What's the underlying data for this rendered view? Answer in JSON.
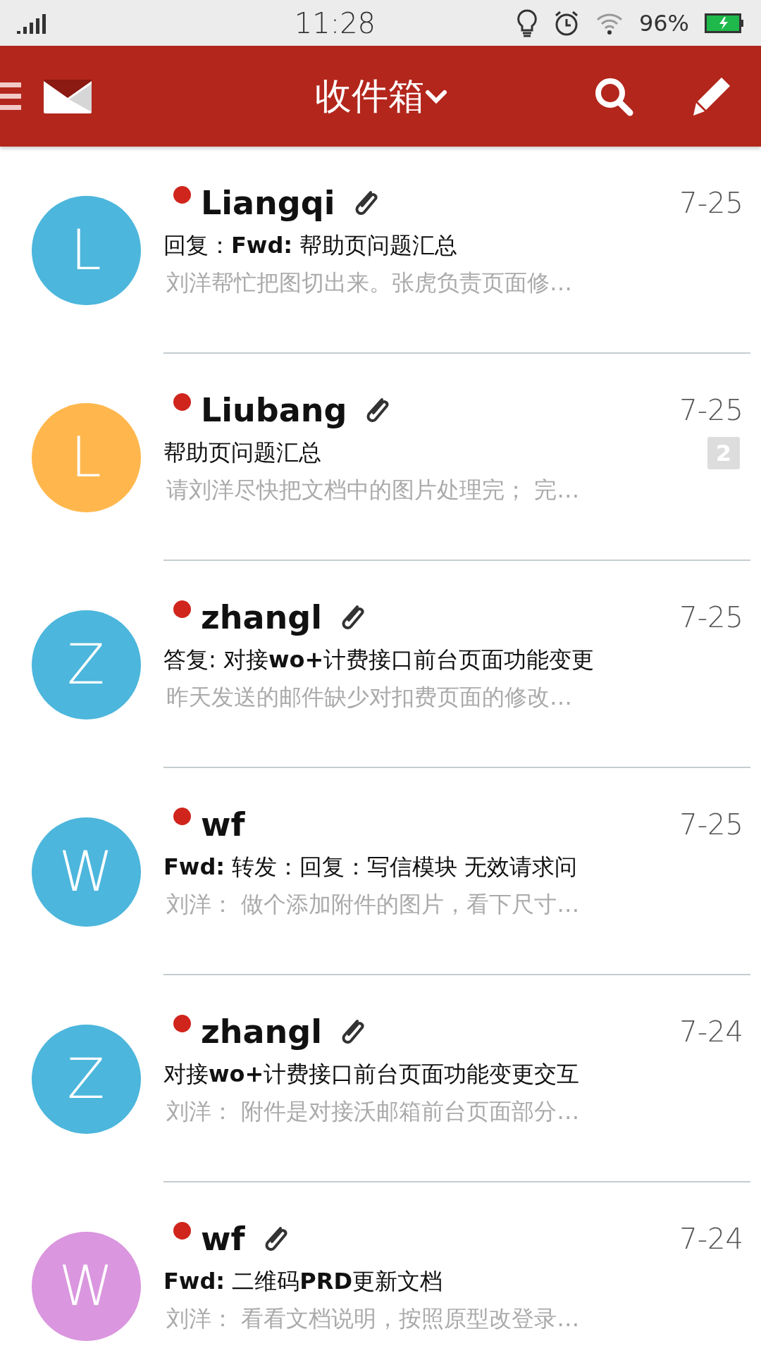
{
  "status_bar": {
    "time": "11:28",
    "battery": "96%"
  },
  "header": {
    "title": "收件箱"
  },
  "messages": [
    {
      "avatar": "L",
      "color": "#4cb6dc",
      "unread": true,
      "sender": "Liangqi",
      "attachment": true,
      "date": "7-25",
      "subject": "回复：**Fwd:** 帮助页问题汇总",
      "preview": "刘洋帮忙把图切出来。张虎负责页面修…"
    },
    {
      "avatar": "L",
      "color": "#ffb74d",
      "unread": true,
      "sender": "Liubang",
      "attachment": true,
      "date": "7-25",
      "subject": "帮助页问题汇总",
      "count": "2",
      "preview": "请刘洋尽快把文档中的图片处理完； 完…"
    },
    {
      "avatar": "Z",
      "color": "#4cb6dc",
      "unread": true,
      "sender": "zhangl",
      "attachment": true,
      "date": "7-25",
      "subject": "答复: 对接**wo+**计费接口前台页面功能变更",
      "preview": "昨天发送的邮件缺少对扣费页面的修改…"
    },
    {
      "avatar": "W",
      "color": "#4cb6dc",
      "unread": true,
      "sender": "wf",
      "attachment": false,
      "date": "7-25",
      "subject": "**Fwd:** 转发：回复：写信模块 无效请求问",
      "preview": "刘洋： 做个添加附件的图片，看下尺寸…"
    },
    {
      "avatar": "Z",
      "color": "#4cb6dc",
      "unread": true,
      "sender": "zhangl",
      "attachment": true,
      "date": "7-24",
      "subject": "对接**wo+**计费接口前台页面功能变更交互",
      "preview": "刘洋： 附件是对接沃邮箱前台页面部分…"
    },
    {
      "avatar": "W",
      "color": "#da96de",
      "unread": true,
      "sender": "wf",
      "attachment": true,
      "date": "7-24",
      "subject": "**Fwd:** 二维码**PRD**更新文档",
      "preview": "刘洋： 看看文档说明，按照原型改登录…"
    }
  ]
}
